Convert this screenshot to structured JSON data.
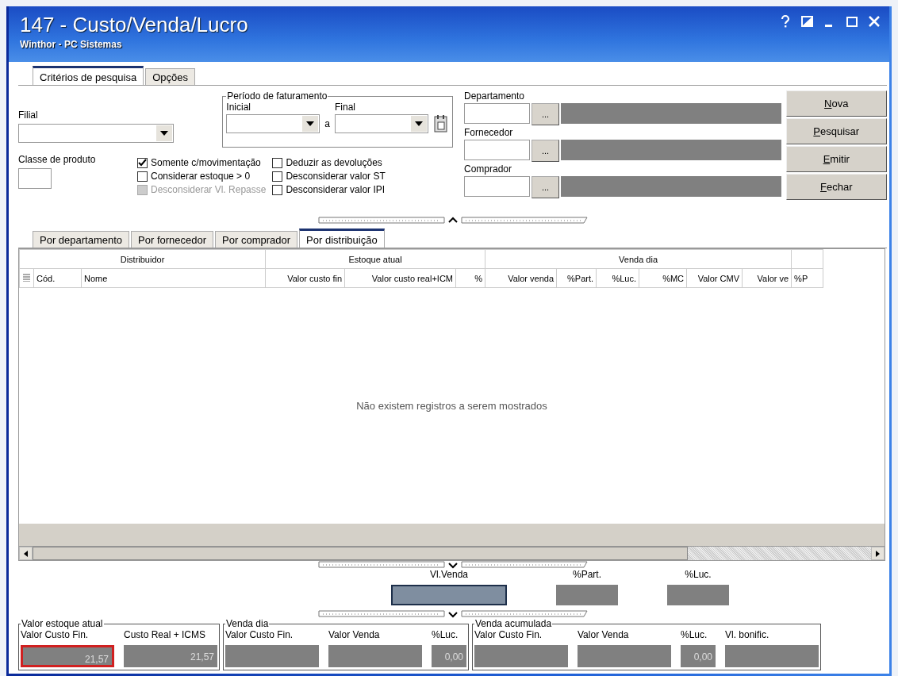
{
  "window": {
    "title": "147 - Custo/Venda/Lucro",
    "subtitle": "Winthor - PC Sistemas"
  },
  "top_tabs": [
    {
      "label": "Critérios de pesquisa",
      "selected": true
    },
    {
      "label": "Opções",
      "selected": false
    }
  ],
  "criteria": {
    "filial": {
      "label": "Filial"
    },
    "periodo": {
      "legend": "Período de faturamento",
      "inicial": "Inicial",
      "separator": "a",
      "final": "Final"
    },
    "classe": {
      "label": "Classe de produto"
    },
    "options": [
      [
        {
          "label": "Somente c/movimentação",
          "checked": true,
          "disabled": false
        },
        {
          "label": "Considerar estoque > 0",
          "checked": false,
          "disabled": false
        },
        {
          "label": "Desconsiderar Vl. Repasse",
          "checked": false,
          "disabled": true
        }
      ],
      [
        {
          "label": "Deduzir as devoluções",
          "checked": false,
          "disabled": false
        },
        {
          "label": "Desconsiderar valor ST",
          "checked": false,
          "disabled": false
        },
        {
          "label": "Desconsiderar valor IPI",
          "checked": false,
          "disabled": false
        }
      ]
    ],
    "lookups": [
      {
        "label": "Departamento",
        "button": "..."
      },
      {
        "label": "Fornecedor",
        "button": "..."
      },
      {
        "label": "Comprador",
        "button": "..."
      }
    ]
  },
  "buttons": [
    {
      "label": "Nova"
    },
    {
      "label": "Pesquisar"
    },
    {
      "label": "Emitir"
    },
    {
      "label": "Fechar"
    }
  ],
  "grid": {
    "tabs": [
      {
        "label": "Por departamento",
        "selected": false
      },
      {
        "label": "Por fornecedor",
        "selected": false
      },
      {
        "label": "Por comprador",
        "selected": false
      },
      {
        "label": "Por distribuição",
        "selected": true
      }
    ],
    "groups": [
      {
        "label": "Distribuidor",
        "columns": [
          {
            "label": "Cód."
          },
          {
            "label": "Nome"
          }
        ]
      },
      {
        "label": "Estoque atual",
        "columns": [
          {
            "label": "Valor custo fin"
          },
          {
            "label": "Valor custo real+ICM"
          },
          {
            "label": "%"
          }
        ]
      },
      {
        "label": "Venda dia",
        "columns": [
          {
            "label": "Valor venda"
          },
          {
            "label": "%Part."
          },
          {
            "label": "%Luc."
          },
          {
            "label": "%MC"
          },
          {
            "label": "Valor CMV"
          },
          {
            "label": "Valor ve"
          }
        ]
      },
      {
        "columns": [
          {
            "label": "%P"
          }
        ]
      }
    ],
    "empty_message": "Não existem registros a serem mostrados"
  },
  "summary": [
    {
      "label": "Vl.Venda",
      "focused": true
    },
    {
      "label": "%Part.",
      "focused": false
    },
    {
      "label": "%Luc.",
      "focused": false
    }
  ],
  "totals": [
    {
      "legend": "Valor estoque  atual",
      "fields": [
        {
          "label": "Valor Custo Fin.",
          "value": "21,57",
          "kind": "amount",
          "focused": true
        },
        {
          "label": "Custo Real + ICMS",
          "value": "21,57",
          "kind": "amount",
          "focused": false
        }
      ]
    },
    {
      "legend": "Venda dia",
      "fields": [
        {
          "label": "Valor Custo Fin.",
          "kind": "amount",
          "focused": false
        },
        {
          "label": "Valor Venda",
          "kind": "amount",
          "focused": false
        },
        {
          "label": "%Luc.",
          "value": "0,00",
          "kind": "percent",
          "focused": false
        }
      ]
    },
    {
      "legend": "Venda acumulada",
      "fields": [
        {
          "label": "Valor Custo Fin.",
          "kind": "amount",
          "focused": false
        },
        {
          "label": "Valor Venda",
          "kind": "amount",
          "focused": false
        },
        {
          "label": "%Luc.",
          "value": "0,00",
          "kind": "percent",
          "focused": false
        },
        {
          "label": "Vl. bonific.",
          "kind": "amount",
          "focused": false
        }
      ]
    }
  ]
}
